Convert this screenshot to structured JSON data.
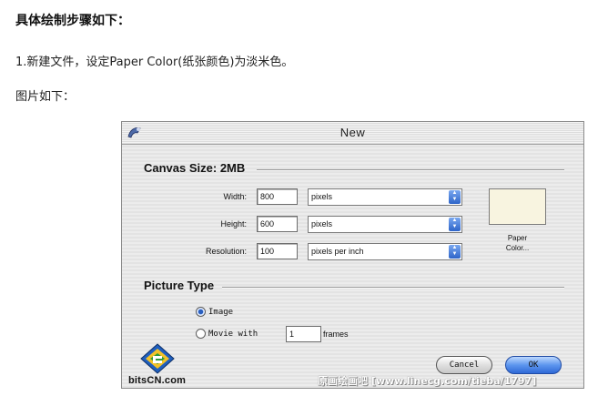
{
  "article": {
    "heading": "具体绘制步骤如下：",
    "step1": "1.新建文件，设定Paper Color(纸张颜色)为淡米色。",
    "caption": "图片如下："
  },
  "dialog": {
    "title": "New",
    "canvas_size_label": "Canvas Size: 2MB",
    "width_label": "Width:",
    "width_value": "800",
    "width_unit": "pixels",
    "height_label": "Height:",
    "height_value": "600",
    "height_unit": "pixels",
    "resolution_label": "Resolution:",
    "resolution_value": "100",
    "resolution_unit": "pixels per inch",
    "paper_color_label": "Paper\nColor...",
    "paper_color_hex": "#f8f4e0",
    "picture_type_label": "Picture Type",
    "image_option": "Image",
    "movie_option": "Movie with",
    "frames_value": "1",
    "frames_label": "frames",
    "cancel_label": "Cancel",
    "ok_label": "OK",
    "logo_text": "bitsCN.com",
    "watermark": "原画绘画吧 [www.linecg.com/tieba/1797]"
  },
  "colors": {
    "accent": "#2e69d6",
    "dialog_bg": "#e8e8e8"
  }
}
